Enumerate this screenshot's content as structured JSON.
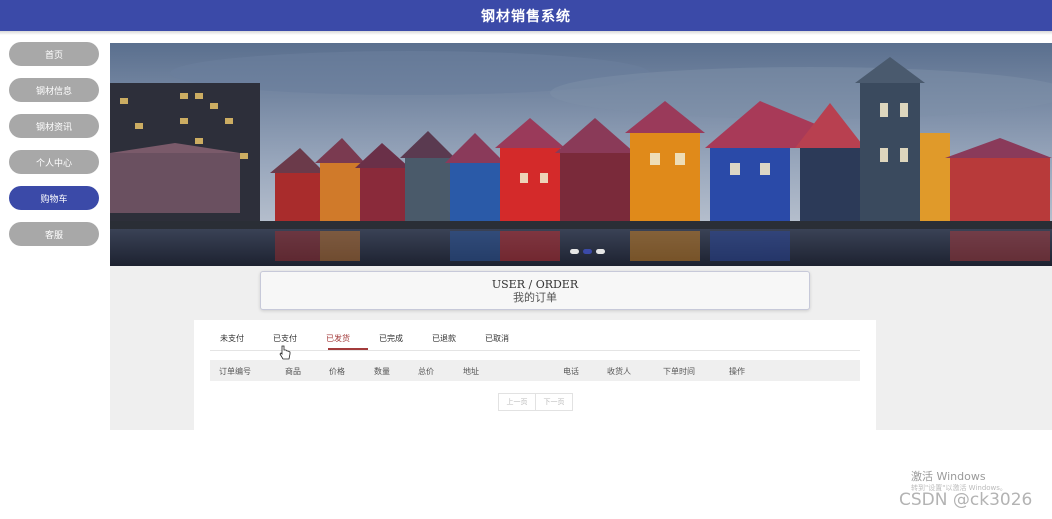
{
  "header": {
    "title": "钢材销售系统",
    "bg_color": "#3b4aa8"
  },
  "nav": {
    "items": [
      {
        "label": "首页",
        "active": false
      },
      {
        "label": "钢材信息",
        "active": false
      },
      {
        "label": "钢材资讯",
        "active": false
      },
      {
        "label": "个人中心",
        "active": false
      },
      {
        "label": "购物车",
        "active": true
      },
      {
        "label": "客服",
        "active": false
      }
    ]
  },
  "banner": {
    "dots": 3,
    "active_dot": 1
  },
  "order_title": {
    "en": "USER / ORDER",
    "zh": "我的订单"
  },
  "tabs": [
    {
      "label": "未支付",
      "active": false
    },
    {
      "label": "已支付",
      "active": false
    },
    {
      "label": "已发货",
      "active": true
    },
    {
      "label": "已完成",
      "active": false
    },
    {
      "label": "已退款",
      "active": false
    },
    {
      "label": "已取消",
      "active": false
    }
  ],
  "table": {
    "columns": [
      "订单编号",
      "商品",
      "价格",
      "数量",
      "总价",
      "地址",
      "电话",
      "收货人",
      "下单时间",
      "操作"
    ],
    "rows": []
  },
  "pagination": {
    "prev": "上一页",
    "next": "下一页"
  },
  "watermark": {
    "activate_title": "激活 Windows",
    "activate_sub": "转到\"设置\"以激活 Windows。",
    "csdn": "CSDN @ck3026"
  }
}
